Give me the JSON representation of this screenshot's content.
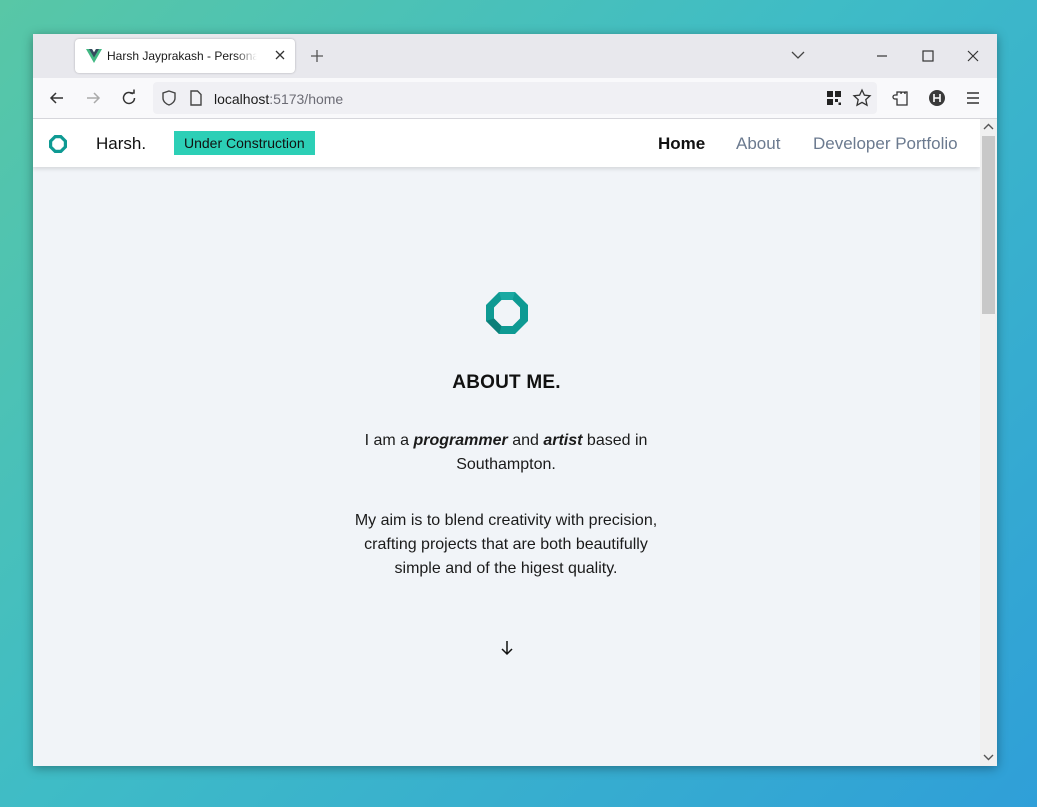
{
  "browser": {
    "tab_title": "Harsh Jayprakash - Personal Portfolio",
    "url_host": "localhost",
    "url_rest": ":5173/home"
  },
  "site": {
    "brand": "Harsh.",
    "badge": "Under Construction",
    "nav": [
      "Home",
      "About",
      "Developer Portfolio"
    ],
    "active_nav": "Home",
    "accent_color": "#2ccfb6"
  },
  "hero": {
    "title": "ABOUT ME.",
    "intro_prefix": "I am a ",
    "intro_word1": "programmer",
    "intro_mid": " and ",
    "intro_word2": "artist",
    "intro_suffix": " based in Southampton.",
    "aim": "My aim is to blend creativity with precision, crafting projects that are both beautifully simple and of the higest quality.",
    "scroll_icon": "arrow-down-icon"
  }
}
